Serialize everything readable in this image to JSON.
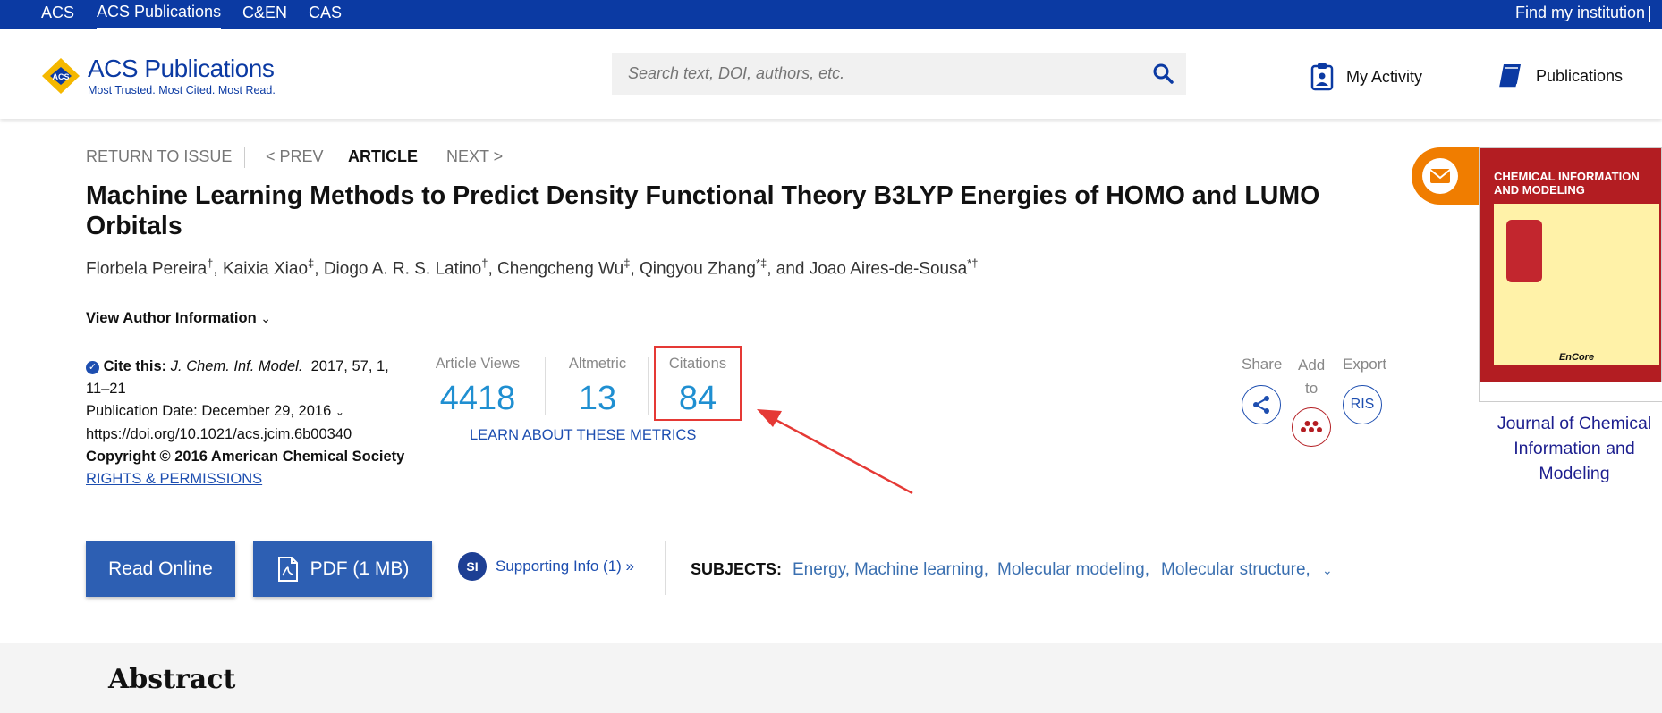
{
  "topnav": {
    "items": [
      "ACS",
      "ACS Publications",
      "C&EN",
      "CAS"
    ],
    "right": "Find my institution"
  },
  "header": {
    "logo_text": "ACS Publications",
    "logo_tag": "Most Trusted. Most Cited. Most Read.",
    "search_placeholder": "Search text, DOI, authors, etc.",
    "my_activity": "My Activity",
    "publications": "Publications"
  },
  "article_nav": {
    "return": "RETURN TO ISSUE",
    "prev": "< PREV",
    "article": "ARTICLE",
    "next": "NEXT >"
  },
  "article": {
    "title": "Machine Learning Methods to Predict Density Functional Theory B3LYP Energies of HOMO and LUMO Orbitals",
    "authors": [
      {
        "name": "Florbela Pereira",
        "sup": "†",
        "sep": ", "
      },
      {
        "name": "Kaixia Xiao",
        "sup": "‡",
        "sep": ", "
      },
      {
        "name": "Diogo A. R. S. Latino",
        "sup": "†",
        "sep": ", "
      },
      {
        "name": "Chengcheng Wu",
        "sup": "‡",
        "sep": ", "
      },
      {
        "name": "Qingyou Zhang",
        "sup": "*‡",
        "sep": ", and "
      },
      {
        "name": "Joao Aires-de-Sousa",
        "sup": "*†",
        "sep": ""
      }
    ],
    "view_author_info": "View Author Information"
  },
  "cite": {
    "label": "Cite this:",
    "journal": "J. Chem. Inf. Model.",
    "ref_line1": "2017, 57, 1,",
    "ref_line2": "11–21",
    "pub_date": "Publication Date: December 29, 2016",
    "doi": "https://doi.org/10.1021/acs.jcim.6b00340",
    "copyright": "Copyright © 2016 American Chemical Society",
    "rights": "RIGHTS & PERMISSIONS"
  },
  "metrics": {
    "views_label": "Article Views",
    "views_value": "4418",
    "altmetric_label": "Altmetric",
    "altmetric_value": "13",
    "citations_label": "Citations",
    "citations_value": "84",
    "learn": "LEARN ABOUT THESE METRICS"
  },
  "actions": {
    "share": "Share",
    "add_to_1": "Add",
    "add_to_2": "to",
    "export": "Export",
    "ris": "RIS"
  },
  "journal": {
    "cover_title_1": "CHEMICAL INFORMATION",
    "cover_title_2": "AND MODELING",
    "cover_footer": "EnCore",
    "name": "Journal of Chemical Information and Modeling"
  },
  "buttons": {
    "read_online": "Read Online",
    "pdf": "PDF (1 MB)",
    "si_badge": "SI",
    "supporting_info": "Supporting Info (1) »"
  },
  "subjects": {
    "label": "SUBJECTS:",
    "items": [
      "Energy,",
      "Machine learning,",
      "Molecular modeling,",
      "Molecular structure,"
    ]
  },
  "abstract": "Abstract",
  "colors": {
    "brand_blue": "#0b3aa3",
    "metric_blue": "#1f8fd1",
    "button_blue": "#2d5fb3",
    "highlight_red": "#e53935",
    "mail_orange": "#f07d00"
  }
}
